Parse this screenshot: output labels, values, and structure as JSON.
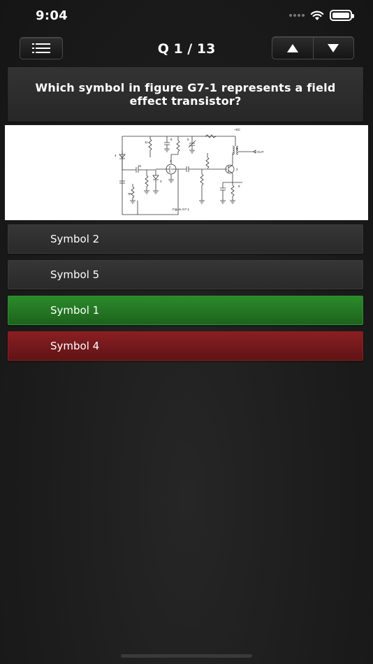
{
  "status_bar": {
    "time": "9:04"
  },
  "nav": {
    "title": "Q 1 / 13",
    "menu_icon": "list-icon",
    "prev_icon": "triangle-up-icon",
    "next_icon": "triangle-down-icon"
  },
  "question": {
    "text": "Which symbol in figure G7-1 represents a field effect transistor?"
  },
  "figure": {
    "caption": "Figure G7-1",
    "labels": {
      "dc": "+DC",
      "out": "OUT",
      "n1": "1",
      "n2": "2",
      "n3": "3",
      "n4": "4",
      "n5": "5",
      "n6": "6",
      "n7": "7",
      "n8": "8",
      "n9": "9",
      "n10": "10",
      "n11": "11"
    }
  },
  "answers": [
    {
      "label": "Symbol 2",
      "state": "neutral"
    },
    {
      "label": "Symbol 5",
      "state": "neutral"
    },
    {
      "label": "Symbol 1",
      "state": "correct"
    },
    {
      "label": "Symbol 4",
      "state": "wrong"
    }
  ],
  "colors": {
    "correct": "#2b8a2b",
    "wrong": "#8a1f22",
    "neutral": "#333333"
  }
}
